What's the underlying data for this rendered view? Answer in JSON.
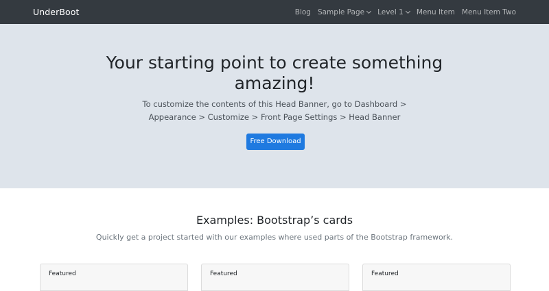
{
  "navbar": {
    "brand": "UnderBoot",
    "items": [
      {
        "label": "Blog",
        "dropdown": false
      },
      {
        "label": "Sample Page",
        "dropdown": true
      },
      {
        "label": "Level 1",
        "dropdown": true
      },
      {
        "label": "Menu Item",
        "dropdown": false
      },
      {
        "label": "Menu Item Two",
        "dropdown": false
      }
    ]
  },
  "hero": {
    "title": "Your starting point to create something amazing!",
    "lead": "To customize the contents of this Head Banner, go to Dashboard > Appearance > Customize > Front Page Settings > Head Banner",
    "button_label": "Free Download"
  },
  "examples": {
    "title": "Examples: Bootstrap’s cards",
    "lead": "Quickly get a project started with our examples where used parts of the Bootstrap framework.",
    "cards": [
      {
        "header": "Featured"
      },
      {
        "header": "Featured"
      },
      {
        "header": "Featured"
      }
    ]
  },
  "colors": {
    "navbar_bg": "#343a40",
    "hero_bg": "#dee4eb",
    "primary": "#1f7ae0"
  },
  "icons": {
    "dropdown": "chevron-down-icon"
  }
}
